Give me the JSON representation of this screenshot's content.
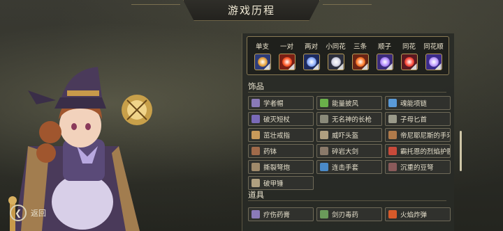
{
  "title": "游戏历程",
  "back_label": "返回",
  "combos": [
    {
      "label": "单支",
      "color": "#e9a33a",
      "bg": "#2c3b7a"
    },
    {
      "label": "一对",
      "color": "#ff5a2a",
      "bg": "#7a1f14"
    },
    {
      "label": "两对",
      "color": "#8fb0ff",
      "bg": "#1c2a5e"
    },
    {
      "label": "小同花",
      "color": "#d8d8e8",
      "bg": "#2b2e3c"
    },
    {
      "label": "三条",
      "color": "#ff7a2a",
      "bg": "#6a2414"
    },
    {
      "label": "顺子",
      "color": "#b58cff",
      "bg": "#3a2a7a"
    },
    {
      "label": "同花",
      "color": "#ff4a3a",
      "bg": "#5a1820"
    },
    {
      "label": "同花顺",
      "color": "#c2a0ff",
      "bg": "#3a2a8a"
    }
  ],
  "sections": {
    "accessories": {
      "title": "饰品",
      "items": [
        {
          "label": "学者帽",
          "icon": "scholar-hat-icon",
          "color": "#8a7ab8"
        },
        {
          "label": "能量披风",
          "icon": "energy-cloak-icon",
          "color": "#6ab04a"
        },
        {
          "label": "魂能项链",
          "icon": "soul-necklace-icon",
          "color": "#5a9ad8"
        },
        {
          "label": "破灭短杖",
          "icon": "short-staff-icon",
          "color": "#7a6ab8"
        },
        {
          "label": "无名神的长枪",
          "icon": "spear-icon",
          "color": "#8a8a7a"
        },
        {
          "label": "子母匕首",
          "icon": "dagger-icon",
          "color": "#9a9a8a"
        },
        {
          "label": "茁壮戒指",
          "icon": "ring-icon",
          "color": "#c89a5a"
        },
        {
          "label": "威吓头盔",
          "icon": "helmet-icon",
          "color": "#b0a080"
        },
        {
          "label": "帝尼耶尼斯的手环",
          "icon": "bracelet-icon",
          "color": "#b07a4a"
        },
        {
          "label": "药钵",
          "icon": "mortar-icon",
          "color": "#a06a4a"
        },
        {
          "label": "碎岩大剑",
          "icon": "greatsword-icon",
          "color": "#8a7a6a"
        },
        {
          "label": "霸托恩的烈焰护腕",
          "icon": "flame-bracer-icon",
          "color": "#c84a3a"
        },
        {
          "label": "撕裂弩炮",
          "icon": "ballista-icon",
          "color": "#a08a6a"
        },
        {
          "label": "连击手套",
          "icon": "glove-icon",
          "color": "#4a8ac8"
        },
        {
          "label": "沉重的豆弩",
          "icon": "crossbow-icon",
          "color": "#8a5a5a"
        },
        {
          "label": "破甲锤",
          "icon": "hammer-icon",
          "color": "#b0a080"
        }
      ]
    },
    "props": {
      "title": "道具",
      "items": [
        {
          "label": "疗伤药膏",
          "icon": "salve-icon",
          "color": "#8a7ab8"
        },
        {
          "label": "剑刃毒药",
          "icon": "poison-icon",
          "color": "#6a9a5a"
        },
        {
          "label": "火焰炸弹",
          "icon": "fire-bomb-icon",
          "color": "#d85a2a"
        }
      ]
    }
  }
}
